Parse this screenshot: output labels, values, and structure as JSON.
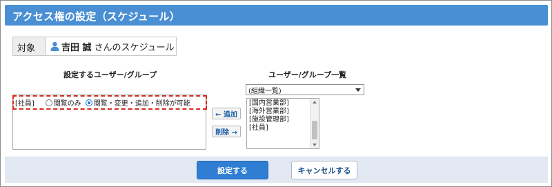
{
  "header": {
    "title": "アクセス権の設定（スケジュール）"
  },
  "target": {
    "label": "対象",
    "user_name": "吉田 誠",
    "suffix": "さんのスケジュール",
    "icon": "person-icon"
  },
  "left_panel": {
    "heading": "設定するユーザー/グループ",
    "rows": [
      {
        "name": "[社員]",
        "options": [
          {
            "label": "閲覧のみ",
            "checked": false
          },
          {
            "label": "閲覧・変更・追加・削除が可能",
            "checked": true
          }
        ]
      }
    ]
  },
  "middle_buttons": {
    "add_label": "← 追加",
    "remove_label": "削除 →"
  },
  "right_panel": {
    "heading": "ユーザー/グループ一覧",
    "select_value": "(組織一覧)",
    "items": [
      "[国内営業部]",
      "[海外営業部]",
      "[施設管理部]",
      "[社員]"
    ]
  },
  "footer": {
    "submit_label": "設定する",
    "cancel_label": "キャンセルする"
  },
  "colors": {
    "title_bar": "#4a8fd3",
    "primary_button": "#2f7ed4",
    "highlight_dashed": "#d9291c",
    "footer_bg": "#e3e9f2"
  }
}
